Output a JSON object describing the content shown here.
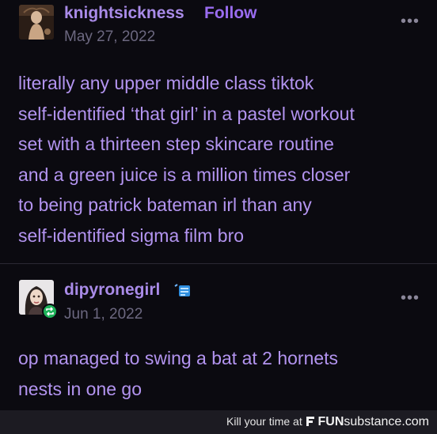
{
  "posts": [
    {
      "username": "knightsickness",
      "follow_label": "Follow",
      "date": "May 27, 2022",
      "lines": [
        "literally any upper middle class tiktok",
        "self-identified ‘that girl’ in a pastel workout",
        "set with a thirteen step skincare routine",
        "and a green juice is a million times closer",
        "to being patrick bateman irl than any",
        "self-identified sigma film bro"
      ]
    },
    {
      "username": "dipyronegirl",
      "date": "Jun 1, 2022",
      "lines": [
        "op managed to swing a bat at 2 hornets",
        "nests in one go"
      ]
    }
  ],
  "menu_glyph": "•••",
  "footer": {
    "prefix": "Kill your time at",
    "brand_fun": "FUN",
    "brand_rest": "substance.com"
  },
  "icons": {
    "menu": "more-options-icon",
    "reblog": "reblog-icon",
    "badge": "blog-badge-icon",
    "footer": "funsubstance-logo-icon"
  },
  "colors": {
    "background": "#0b0a10",
    "text": "#b394f0",
    "username": "#a98be8",
    "follow": "#9a6cf0",
    "date": "#6c6880",
    "reblog_badge": "#1fb35a"
  }
}
